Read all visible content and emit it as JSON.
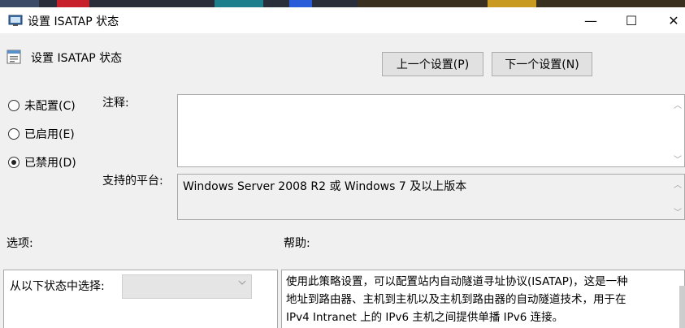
{
  "window": {
    "title": "设置 ISATAP 状态"
  },
  "caption": {
    "minimize": "—",
    "maximize": "☐",
    "close": "✕"
  },
  "header": {
    "title": "设置 ISATAP 状态",
    "prev_label": "上一个设置(P)",
    "next_label": "下一个设置(N)"
  },
  "radios": [
    {
      "label": "未配置(C)",
      "checked": false
    },
    {
      "label": "已启用(E)",
      "checked": false
    },
    {
      "label": "已禁用(D)",
      "checked": true
    }
  ],
  "comment": {
    "label": "注释:",
    "value": ""
  },
  "platform": {
    "label": "支持的平台:",
    "value": "Windows Server 2008 R2 或 Windows 7 及以上版本"
  },
  "options": {
    "label": "选项:",
    "select_label": "从以下状态中选择:",
    "select_value": ""
  },
  "help": {
    "label": "帮助:",
    "lines": [
      "使用此策略设置，可以配置站内自动隧道寻址协议(ISATAP)，这是一种",
      "地址到路由器、主机到主机以及主机到路由器的自动隧道技术，用于在",
      "IPv4 Intranet 上的 IPv6 主机之间提供单播 IPv6 连接。"
    ]
  },
  "icons": {
    "title_icon": "policy-window-icon",
    "header_icon": "policy-setting-icon",
    "scroll_up": "scroll-up-arrow-icon",
    "scroll_down": "scroll-down-arrow-icon",
    "dropdown": "chevron-down-icon"
  },
  "colors": {
    "window_bg": "#f0f0f0",
    "button_bg": "#e1e1e1",
    "border": "#a9a9a9"
  }
}
